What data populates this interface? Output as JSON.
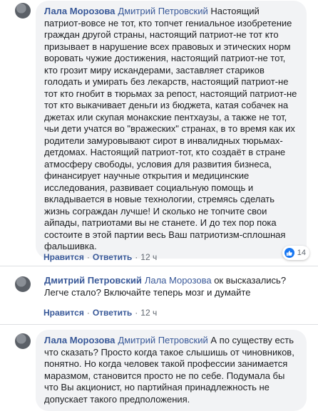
{
  "comments": [
    {
      "author": "Лала Морозова",
      "mention": "Дмитрий Петровский",
      "text": "Настоящий патриот-вовсе не тот, кто топчет гениальное изобретение граждан другой страны, настоящий патриот-не тот кто призывает в нарушение всех правовых и этических норм воровать чужие достижения, настоящий патриот-не тот, кто грозит миру искандерами, заставляет стариков голодать и умирать без лекарств, настоящий патриот-не тот кто гнобит в тюрьмах за репост, настоящий патриот-не тот кто выкачивает деньги из бюджета, катая собачек на джетах или скупая монакские пентхаузы, а также не тот, чьи дети учатся во \"вражеских\" странах, в то время как их родители замуровывают сирот в инвалидных тюрьмах-детдомах. Настоящий патриот-тот, кто создаёт в стране атмосферу свободы, условия для развития бизнеса, финансирует научные открытия и медицинские исследования, развивает социальную помощь и вкладывается в новые технологии, стремясь сделать жизнь сограждан лучше! И сколько не топчите свои айпады, патриотами вы не станете. И до тех пор пока состоите в этой партии весь Ваш патриотизм-сплошная фальшивка.",
      "like_label": "Нравится",
      "reply_label": "Ответить",
      "time": "12 ч",
      "reactions": "14"
    },
    {
      "author": "Дмитрий Петровский",
      "mention": "Лала Морозова",
      "text": "ок высказались? Легче стало? Включайте теперь мозг и думайте",
      "like_label": "Нравится",
      "reply_label": "Ответить",
      "time": "12 ч"
    },
    {
      "author": "Лала Морозова",
      "mention": "Дмитрий Петровский",
      "text": "А по существу есть что сказать? Просто когда такое слышишь от чиновников, понятно. Но когда человек такой профессии занимается маразмом, становится просто не по себе. Подумала бы что Вы акционист, но партийная принадлежность не допускает такого предположения."
    }
  ]
}
